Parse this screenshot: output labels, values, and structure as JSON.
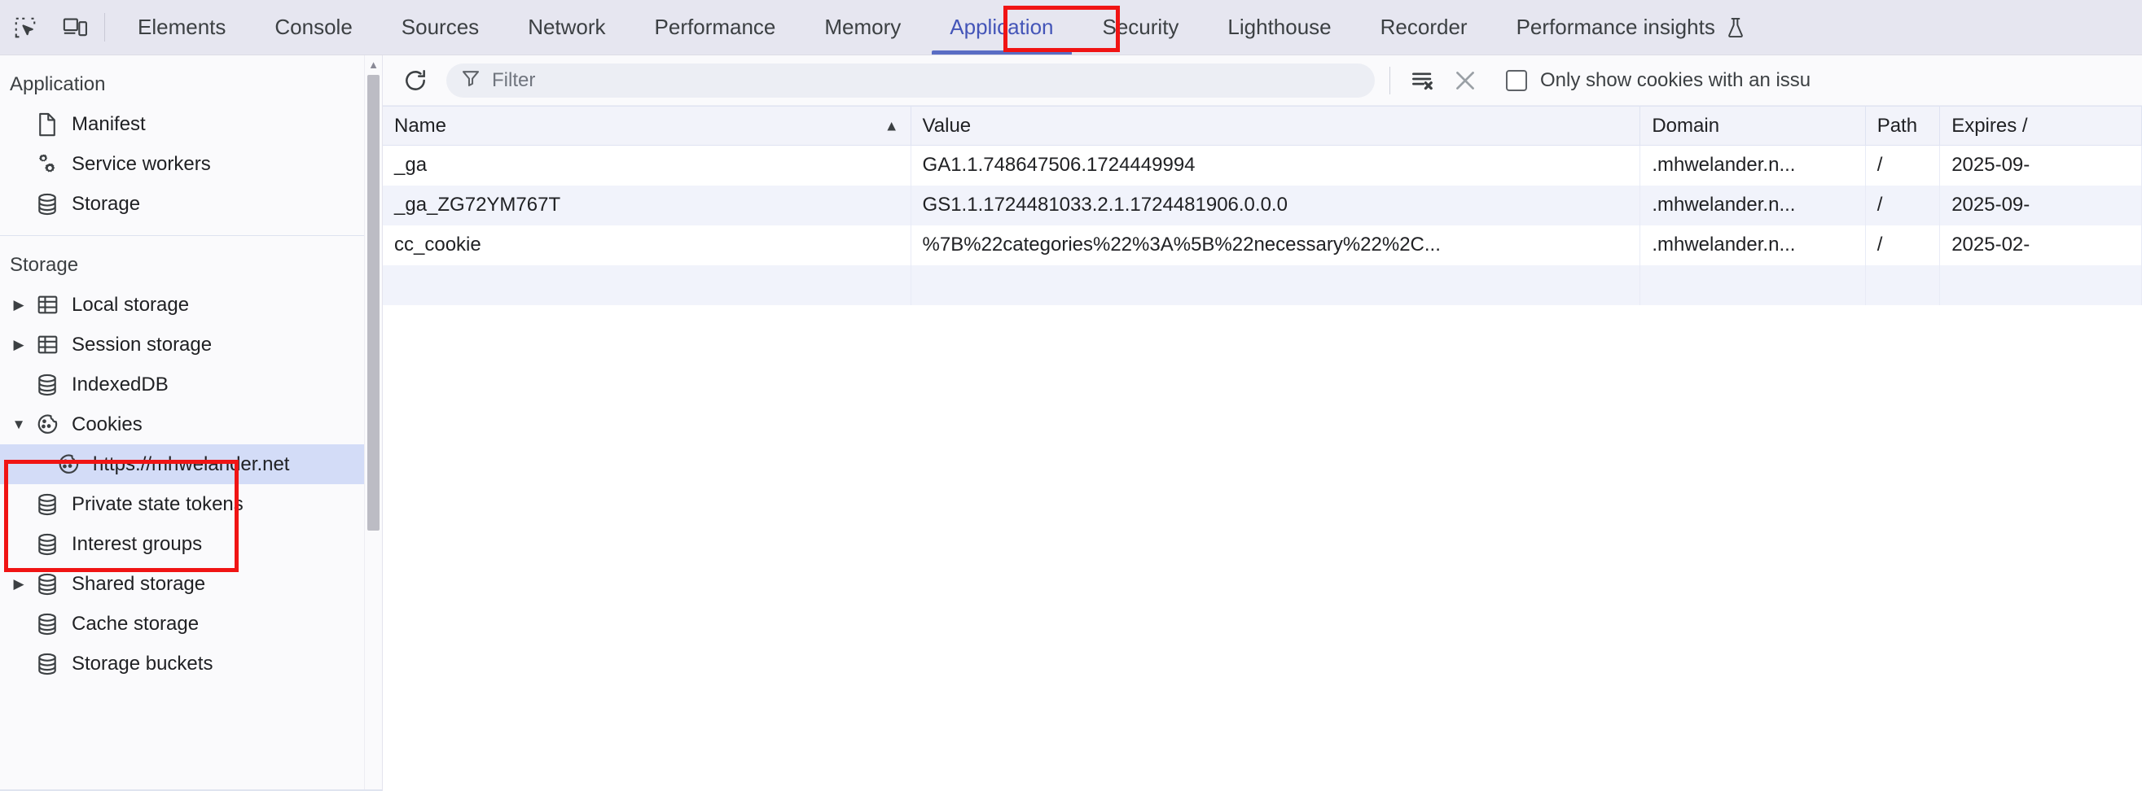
{
  "tabbar": {
    "inspect_icon": "inspect-element-icon",
    "device_icon": "device-toolbar-icon",
    "tabs": [
      {
        "label": "Elements",
        "active": false
      },
      {
        "label": "Console",
        "active": false
      },
      {
        "label": "Sources",
        "active": false
      },
      {
        "label": "Network",
        "active": false
      },
      {
        "label": "Performance",
        "active": false
      },
      {
        "label": "Memory",
        "active": false
      },
      {
        "label": "Application",
        "active": true
      },
      {
        "label": "Security",
        "active": false
      },
      {
        "label": "Lighthouse",
        "active": false
      },
      {
        "label": "Recorder",
        "active": false
      },
      {
        "label": "Performance insights",
        "active": false,
        "experimental": true
      }
    ],
    "active_tab_color": "#4455b8",
    "background": "#e6e6f0"
  },
  "annotations": {
    "color": "#f01414",
    "boxes": [
      "application-tab",
      "cookies-origin"
    ]
  },
  "sidebar": {
    "sections": [
      {
        "title": "Application",
        "items": [
          {
            "label": "Manifest",
            "icon": "document-icon",
            "twisty": "",
            "indent": 2
          },
          {
            "label": "Service workers",
            "icon": "gears-icon",
            "twisty": "",
            "indent": 2
          },
          {
            "label": "Storage",
            "icon": "database-icon",
            "twisty": "",
            "indent": 2
          }
        ]
      },
      {
        "title": "Storage",
        "items": [
          {
            "label": "Local storage",
            "icon": "table-icon",
            "twisty": "collapsed",
            "indent": 1
          },
          {
            "label": "Session storage",
            "icon": "table-icon",
            "twisty": "collapsed",
            "indent": 1
          },
          {
            "label": "IndexedDB",
            "icon": "database-icon",
            "twisty": "",
            "indent": 2
          },
          {
            "label": "Cookies",
            "icon": "cookie-icon",
            "twisty": "expanded",
            "indent": 1
          },
          {
            "label": "https://mhwelander.net",
            "icon": "cookie-icon",
            "twisty": "",
            "indent": 3,
            "selected": true
          },
          {
            "label": "Private state tokens",
            "icon": "database-icon",
            "twisty": "",
            "indent": 2
          },
          {
            "label": "Interest groups",
            "icon": "database-icon",
            "twisty": "",
            "indent": 2
          },
          {
            "label": "Shared storage",
            "icon": "database-icon",
            "twisty": "collapsed",
            "indent": 1
          },
          {
            "label": "Cache storage",
            "icon": "database-icon",
            "twisty": "",
            "indent": 2
          },
          {
            "label": "Storage buckets",
            "icon": "database-icon",
            "twisty": "",
            "indent": 2
          }
        ]
      }
    ],
    "selected_highlight": "#d3dcf7"
  },
  "toolbar": {
    "refresh_icon": "refresh-icon",
    "filter_icon": "filter-funnel-icon",
    "filter_placeholder": "Filter",
    "filter_value": "",
    "clear_all_icon": "clear-all-cookies-icon",
    "close_icon": "close-icon",
    "checkbox_label": "Only show cookies with an issu",
    "checkbox_checked": false
  },
  "table": {
    "columns": [
      {
        "key": "name",
        "label": "Name",
        "sort": "asc"
      },
      {
        "key": "value",
        "label": "Value",
        "sort": ""
      },
      {
        "key": "domain",
        "label": "Domain",
        "sort": ""
      },
      {
        "key": "path",
        "label": "Path",
        "sort": ""
      },
      {
        "key": "expires",
        "label": "Expires /",
        "sort": ""
      }
    ],
    "rows": [
      {
        "name": "_ga",
        "value": "GA1.1.748647506.1724449994",
        "domain": ".mhwelander.n...",
        "path": "/",
        "expires": "2025-09-"
      },
      {
        "name": "_ga_ZG72YM767T",
        "value": "GS1.1.1724481033.2.1.1724481906.0.0.0",
        "domain": ".mhwelander.n...",
        "path": "/",
        "expires": "2025-09-"
      },
      {
        "name": "cc_cookie",
        "value": "%7B%22categories%22%3A%5B%22necessary%22%2C...",
        "domain": ".mhwelander.n...",
        "path": "/",
        "expires": "2025-02-"
      }
    ]
  }
}
